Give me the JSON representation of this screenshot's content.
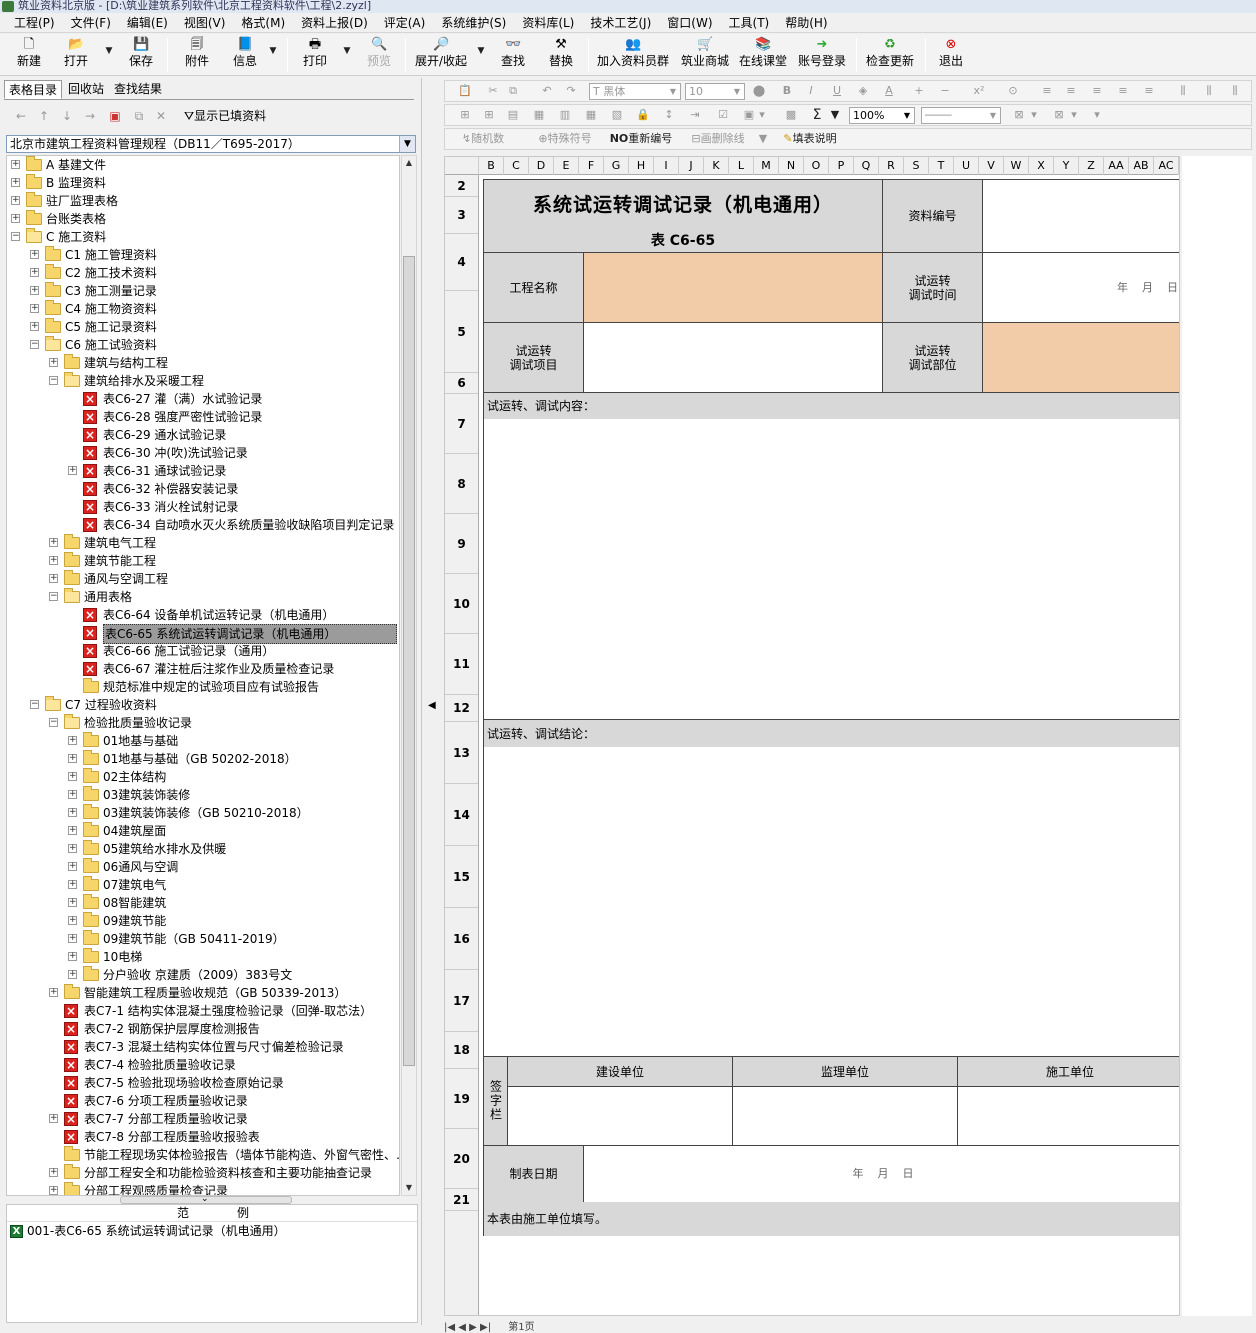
{
  "window": {
    "title": "筑业资料北京版 - [D:\\筑业建筑系列软件\\北京工程资料软件\\工程\\2.zyzl]"
  },
  "menu": [
    "工程(P)",
    "文件(F)",
    "编辑(E)",
    "视图(V)",
    "格式(M)",
    "资料上报(D)",
    "评定(A)",
    "系统维护(S)",
    "资料库(L)",
    "技术工艺(J)",
    "窗口(W)",
    "工具(T)",
    "帮助(H)"
  ],
  "toolbar": {
    "new": "新建",
    "open": "打开",
    "save": "保存",
    "attach": "附件",
    "info": "信息",
    "print": "打印",
    "preview": "预览",
    "expand": "展开/收起",
    "find": "查找",
    "replace": "替换",
    "join_group": "加入资料员群",
    "mall": "筑业商城",
    "online_class": "在线课堂",
    "account_login": "账号登录",
    "check_update": "检查更新",
    "exit": "退出"
  },
  "left": {
    "tabs": [
      "表格目录",
      "回收站",
      "查找结果"
    ],
    "show_filled": "显示已填资料",
    "standard": "北京市建筑工程资料管理规程（DB11／T695-2017）",
    "tree": [
      {
        "t": "A 基建文件",
        "d": 0,
        "k": "f",
        "e": "+"
      },
      {
        "t": "B 监理资料",
        "d": 0,
        "k": "f",
        "e": "+"
      },
      {
        "t": "驻厂监理表格",
        "d": 0,
        "k": "f",
        "e": "+"
      },
      {
        "t": "台账类表格",
        "d": 0,
        "k": "f",
        "e": "+"
      },
      {
        "t": "C 施工资料",
        "d": 0,
        "k": "o",
        "e": "-"
      },
      {
        "t": "C1 施工管理资料",
        "d": 1,
        "k": "f",
        "e": "+"
      },
      {
        "t": "C2 施工技术资料",
        "d": 1,
        "k": "f",
        "e": "+"
      },
      {
        "t": "C3 施工测量记录",
        "d": 1,
        "k": "f",
        "e": "+"
      },
      {
        "t": "C4 施工物资资料",
        "d": 1,
        "k": "f",
        "e": "+"
      },
      {
        "t": "C5 施工记录资料",
        "d": 1,
        "k": "f",
        "e": "+"
      },
      {
        "t": "C6 施工试验资料",
        "d": 1,
        "k": "o",
        "e": "-"
      },
      {
        "t": "建筑与结构工程",
        "d": 2,
        "k": "f",
        "e": "+"
      },
      {
        "t": "建筑给排水及采暖工程",
        "d": 2,
        "k": "o",
        "e": "-"
      },
      {
        "t": "表C6-27 灌（满）水试验记录",
        "d": 3,
        "k": "x",
        "e": ""
      },
      {
        "t": "表C6-28 强度严密性试验记录",
        "d": 3,
        "k": "x",
        "e": ""
      },
      {
        "t": "表C6-29 通水试验记录",
        "d": 3,
        "k": "x",
        "e": ""
      },
      {
        "t": "表C6-30 冲(吹)洗试验记录",
        "d": 3,
        "k": "x",
        "e": ""
      },
      {
        "t": "表C6-31 通球试验记录",
        "d": 3,
        "k": "x",
        "e": "+"
      },
      {
        "t": "表C6-32 补偿器安装记录",
        "d": 3,
        "k": "x",
        "e": ""
      },
      {
        "t": "表C6-33 消火栓试射记录",
        "d": 3,
        "k": "x",
        "e": ""
      },
      {
        "t": "表C6-34 自动喷水灭火系统质量验收缺陷项目判定记录",
        "d": 3,
        "k": "x",
        "e": ""
      },
      {
        "t": "建筑电气工程",
        "d": 2,
        "k": "f",
        "e": "+"
      },
      {
        "t": "建筑节能工程",
        "d": 2,
        "k": "f",
        "e": "+"
      },
      {
        "t": "通风与空调工程",
        "d": 2,
        "k": "f",
        "e": "+"
      },
      {
        "t": "通用表格",
        "d": 2,
        "k": "o",
        "e": "-"
      },
      {
        "t": "表C6-64 设备单机试运转记录（机电通用）",
        "d": 3,
        "k": "x",
        "e": ""
      },
      {
        "t": "表C6-65 系统试运转调试记录（机电通用）",
        "d": 3,
        "k": "x",
        "e": "",
        "sel": true
      },
      {
        "t": "表C6-66 施工试验记录（通用）",
        "d": 3,
        "k": "x",
        "e": ""
      },
      {
        "t": "表C6-67 灌注桩后注浆作业及质量检查记录",
        "d": 3,
        "k": "x",
        "e": ""
      },
      {
        "t": "规范标准中规定的试验项目应有试验报告",
        "d": 3,
        "k": "f",
        "e": ""
      },
      {
        "t": "C7 过程验收资料",
        "d": 1,
        "k": "o",
        "e": "-"
      },
      {
        "t": "检验批质量验收记录",
        "d": 2,
        "k": "o",
        "e": "-"
      },
      {
        "t": "01地基与基础",
        "d": 3,
        "k": "f",
        "e": "+"
      },
      {
        "t": "01地基与基础（GB 50202-2018）",
        "d": 3,
        "k": "f",
        "e": "+"
      },
      {
        "t": "02主体结构",
        "d": 3,
        "k": "f",
        "e": "+"
      },
      {
        "t": "03建筑装饰装修",
        "d": 3,
        "k": "f",
        "e": "+"
      },
      {
        "t": "03建筑装饰装修（GB 50210-2018）",
        "d": 3,
        "k": "f",
        "e": "+"
      },
      {
        "t": "04建筑屋面",
        "d": 3,
        "k": "f",
        "e": "+"
      },
      {
        "t": "05建筑给水排水及供暖",
        "d": 3,
        "k": "f",
        "e": "+"
      },
      {
        "t": "06通风与空调",
        "d": 3,
        "k": "f",
        "e": "+"
      },
      {
        "t": "07建筑电气",
        "d": 3,
        "k": "f",
        "e": "+"
      },
      {
        "t": "08智能建筑",
        "d": 3,
        "k": "f",
        "e": "+"
      },
      {
        "t": "09建筑节能",
        "d": 3,
        "k": "f",
        "e": "+"
      },
      {
        "t": "09建筑节能（GB 50411-2019）",
        "d": 3,
        "k": "f",
        "e": "+"
      },
      {
        "t": "10电梯",
        "d": 3,
        "k": "f",
        "e": "+"
      },
      {
        "t": "分户验收 京建质（2009）383号文",
        "d": 3,
        "k": "f",
        "e": "+"
      },
      {
        "t": "智能建筑工程质量验收规范（GB 50339-2013）",
        "d": 2,
        "k": "f",
        "e": "+"
      },
      {
        "t": "表C7-1 结构实体混凝土强度检验记录（回弹-取芯法）",
        "d": 2,
        "k": "x",
        "e": ""
      },
      {
        "t": "表C7-2 钢筋保护层厚度检测报告",
        "d": 2,
        "k": "x",
        "e": ""
      },
      {
        "t": "表C7-3 混凝土结构实体位置与尺寸偏差检验记录",
        "d": 2,
        "k": "x",
        "e": ""
      },
      {
        "t": "表C7-4 检验批质量验收记录",
        "d": 2,
        "k": "x",
        "e": ""
      },
      {
        "t": "表C7-5 检验批现场验收检查原始记录",
        "d": 2,
        "k": "x",
        "e": ""
      },
      {
        "t": "表C7-6 分项工程质量验收记录",
        "d": 2,
        "k": "x",
        "e": ""
      },
      {
        "t": "表C7-7 分部工程质量验收记录",
        "d": 2,
        "k": "x",
        "e": "+"
      },
      {
        "t": "表C7-8 分部工程质量验收报验表",
        "d": 2,
        "k": "x",
        "e": ""
      },
      {
        "t": "节能工程现场实体检验报告（墙体节能构造、外窗气密性、…",
        "d": 2,
        "k": "f",
        "e": ""
      },
      {
        "t": "分部工程安全和功能检验资料核查和主要功能抽查记录",
        "d": 2,
        "k": "f",
        "e": "+"
      },
      {
        "t": "分部工程观感质量检查记录",
        "d": 2,
        "k": "f",
        "e": "+"
      }
    ],
    "bottom_header": [
      "范",
      "例"
    ],
    "bottom_item": "001-表C6-65 系统试运转调试记录（机电通用）"
  },
  "format": {
    "font": "黑体",
    "size": "10",
    "zoom": "100%",
    "random_num": "随机数",
    "special_char": "特殊符号",
    "renumber": "重新编号",
    "strike": "画删除线",
    "fill_desc": "填表说明",
    "no_prefix": "NO"
  },
  "sheet": {
    "columns": [
      "B",
      "C",
      "D",
      "E",
      "F",
      "G",
      "H",
      "I",
      "J",
      "K",
      "L",
      "M",
      "N",
      "O",
      "P",
      "Q",
      "R",
      "S",
      "T",
      "U",
      "V",
      "W",
      "X",
      "Y",
      "Z",
      "AA",
      "AB",
      "AC"
    ],
    "rows": [
      "2",
      "3",
      "4",
      "5",
      "6",
      "7",
      "8",
      "9",
      "10",
      "11",
      "12",
      "13",
      "14",
      "15",
      "16",
      "17",
      "18",
      "19",
      "20",
      "21"
    ],
    "title": "系统试运转调试记录（机电通用）",
    "code": "表 C6-65",
    "doc_no_label": "资料编号",
    "project_name_label": "工程名称",
    "trial_time_label": "试运转\n调试时间",
    "date_placeholder": "年    月    日",
    "trial_item_label": "试运转\n调试项目",
    "trial_part_label": "试运转\n调试部位",
    "content_label": "试运转、调试内容：",
    "conclusion_label": "试运转、调试结论：",
    "sign_label": "签字栏",
    "owner_unit": "建设单位",
    "supervisor_unit": "监理单位",
    "construction_unit": "施工单位",
    "date_label": "制表日期",
    "date_value": "年    月    日",
    "footer_note": "本表由施工单位填写。",
    "sheet_tab": "第1页"
  }
}
